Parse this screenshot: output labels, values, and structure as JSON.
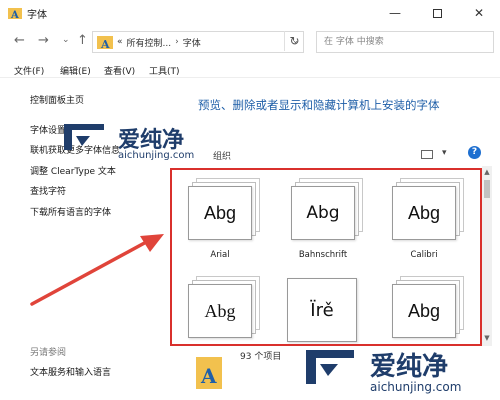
{
  "window": {
    "title": "字体",
    "controls": {
      "minimize": "—",
      "close": "✕"
    }
  },
  "nav": {
    "back": "←",
    "forward": "→",
    "recent": "⌄",
    "up": "↑",
    "breadcrumb_prefix": "«",
    "breadcrumb_parent": "所有控制...",
    "breadcrumb_sep": "›",
    "breadcrumb_current": "字体",
    "dropdown": "⌄",
    "refresh": "↻",
    "search_placeholder": "在 字体 中搜索"
  },
  "menubar": [
    "文件(F)",
    "编辑(E)",
    "查看(V)",
    "工具(T)"
  ],
  "left_pane": {
    "links": [
      "控制面板主页",
      "字体设置",
      "联机获取更多字体信息",
      "调整 ClearType 文本",
      "查找字符",
      "下载所有语言的字体"
    ],
    "see_also_heading": "另请参阅",
    "see_also_links": [
      "文本服务和输入语言"
    ]
  },
  "content": {
    "heading": "预览、删除或者显示和隐藏计算机上安装的字体",
    "sort_label": "组织",
    "help": "?",
    "view_chevron": "▾",
    "fonts": [
      {
        "name": "Arial",
        "sample": "Abg"
      },
      {
        "name": "Bahnschrift",
        "sample": "Abg"
      },
      {
        "name": "Calibri",
        "sample": "Abg"
      },
      {
        "name": "",
        "sample": "Abg"
      },
      {
        "name": "",
        "sample": "Ïrě"
      },
      {
        "name": "",
        "sample": "Abg"
      }
    ],
    "scroll_up": "▲",
    "scroll_down": "▼"
  },
  "status": {
    "item_count": "93 个项目"
  },
  "watermark": {
    "brand": "爱纯净",
    "url": "aichunjing.com"
  },
  "colors": {
    "accent": "#1f5fa8",
    "highlight_border": "#d9302c",
    "arrow": "#e0443a",
    "watermark": "#1f3d6b"
  }
}
